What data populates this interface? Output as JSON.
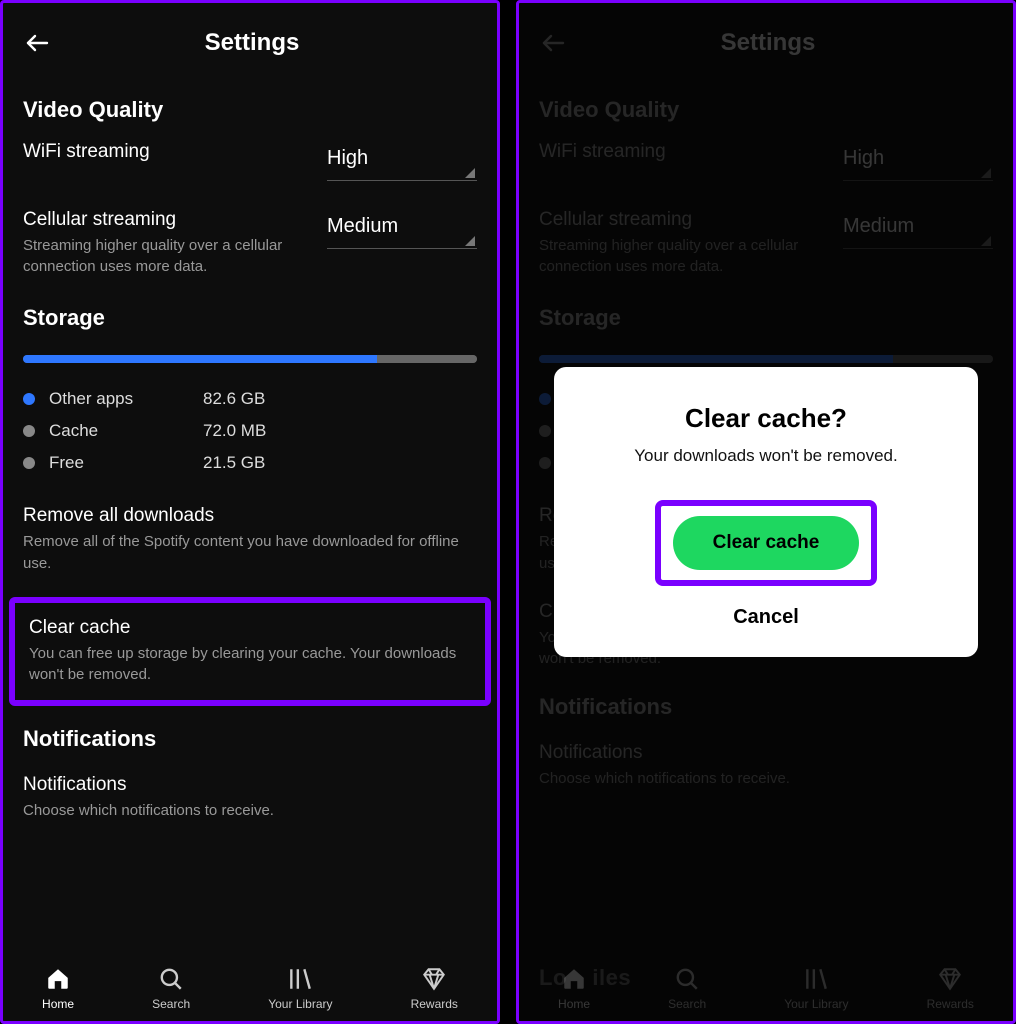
{
  "header": {
    "title": "Settings"
  },
  "video": {
    "section": "Video Quality",
    "wifi_label": "WiFi streaming",
    "wifi_value": "High",
    "cell_label": "Cellular streaming",
    "cell_sub": "Streaming higher quality over a cellular connection uses more data.",
    "cell_value": "Medium"
  },
  "storage": {
    "section": "Storage",
    "bar_blue_pct": 78,
    "bar_grey_pct": 22,
    "legend": [
      {
        "name": "Other apps",
        "value": "82.6 GB",
        "dot": "blue"
      },
      {
        "name": "Cache",
        "value": "72.0 MB",
        "dot": "grey"
      },
      {
        "name": "Free",
        "value": "21.5 GB",
        "dot": "grey"
      }
    ],
    "remove_title": "Remove all downloads",
    "remove_sub": "Remove all of the Spotify content you have downloaded for offline use.",
    "clear_title": "Clear cache",
    "clear_sub": "You can free up storage by clearing your cache. Your downloads won't be removed."
  },
  "notifications": {
    "section": "Notifications",
    "item_title": "Notifications",
    "item_sub": "Choose which notifications to receive."
  },
  "local_files_hint": "Local Files",
  "nav": {
    "home": "Home",
    "search": "Search",
    "library": "Your Library",
    "rewards": "Rewards"
  },
  "dialog": {
    "title": "Clear cache?",
    "message": "Your downloads won't be removed.",
    "confirm": "Clear cache",
    "cancel": "Cancel"
  }
}
